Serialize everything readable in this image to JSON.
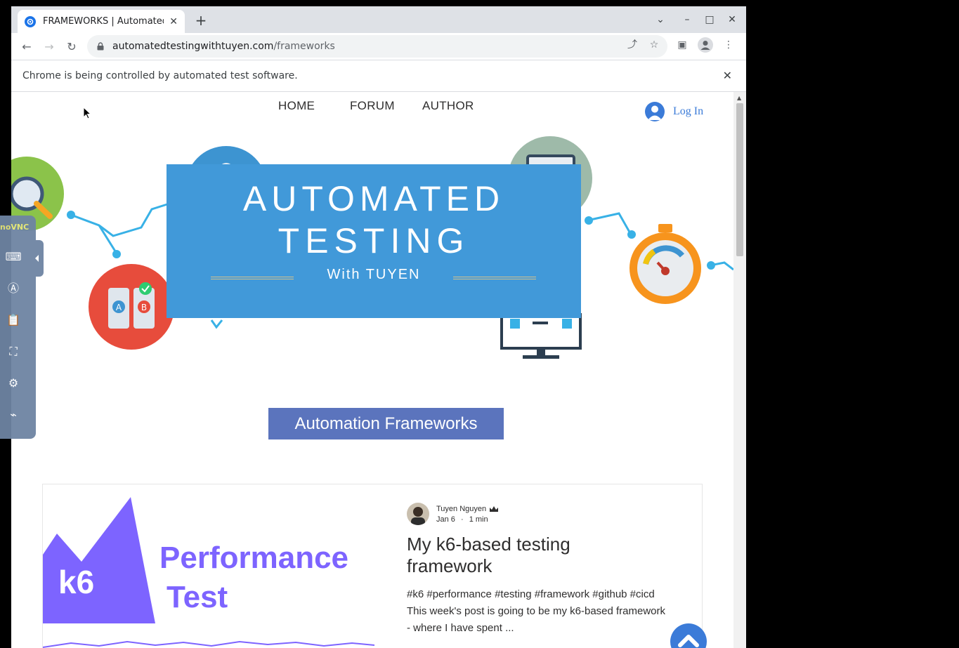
{
  "browser": {
    "tab_title": "FRAMEWORKS | Automated Testing",
    "tab_close": "✕",
    "new_tab": "+",
    "url_host": "automatedtestingwithtuyen.com",
    "url_path": "/frameworks",
    "infobar_message": "Chrome is being controlled by automated test software.",
    "infobar_close": "✕"
  },
  "site_nav": {
    "items": [
      "HOME",
      "FORUM",
      "AUTHOR"
    ],
    "login_label": "Log In"
  },
  "hero": {
    "line1": "AUTOMATED",
    "line2": "TESTING",
    "line3": "With TUYEN"
  },
  "section": {
    "title": "Automation Frameworks"
  },
  "post": {
    "author": "Tuyen Nguyen",
    "date": "Jan 6",
    "separator": "·",
    "read_time": "1 min",
    "title": "My k6-based testing framework",
    "excerpt": "#k6 #performance #testing #framework #github #cicd This week's post is going to be my k6-based framework - where I have spent ...",
    "thumb_logo": "k6",
    "thumb_line1": "Performance",
    "thumb_line2": "Test"
  },
  "vnc": {
    "logo": "noVNC"
  },
  "colors": {
    "banner": "#4199d9",
    "section_bg": "#5b74bd",
    "link": "#3b7bd8",
    "k6_purple": "#7d64ff"
  }
}
